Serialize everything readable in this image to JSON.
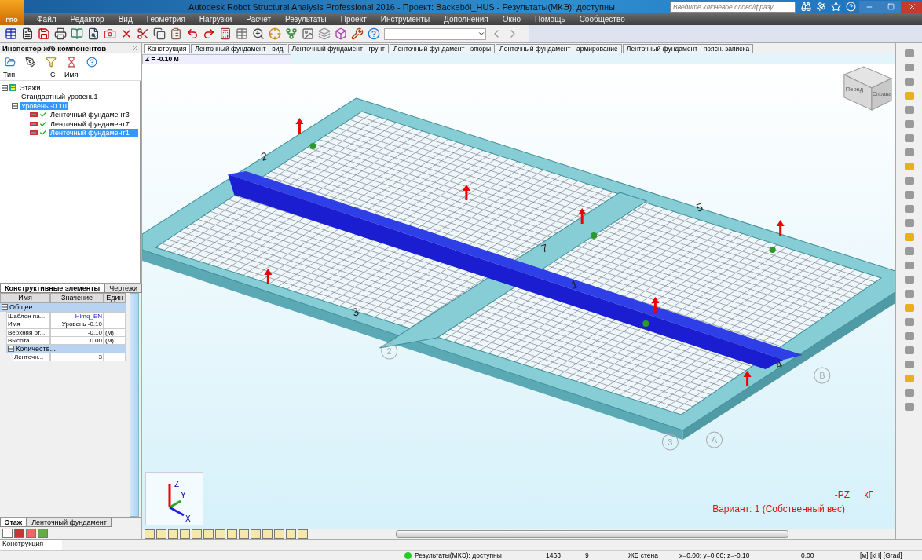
{
  "app": {
    "logo": "PRO",
    "title": "Autodesk Robot Structural Analysis Professional 2016 - Проект: Backeböl_HUS - Результаты(МКЭ): доступны",
    "search_placeholder": "Введите ключевое слово/фразу"
  },
  "menu": [
    "Файл",
    "Редактор",
    "Вид",
    "Геометрия",
    "Нагрузки",
    "Расчет",
    "Результаты",
    "Проект",
    "Инструменты",
    "Дополнения",
    "Окно",
    "Помощь",
    "Сообщество"
  ],
  "inspector": {
    "title": "Инспектор ж/б компонентов",
    "columns": [
      "Тип",
      "С",
      "Имя"
    ],
    "tree": [
      {
        "label": "Этажи",
        "kind": "storeys",
        "expanded": true,
        "selected": false,
        "children": [
          {
            "label": "Стандартный уровень1",
            "selected": false
          },
          {
            "label": "Уровень -0.10",
            "expanded": true,
            "selected": true,
            "children": [
              {
                "label": "Ленточный фундамент3",
                "kind": "footing",
                "checked": true,
                "selected": false
              },
              {
                "label": "Ленточный фундамент7",
                "kind": "footing",
                "checked": true,
                "selected": false
              },
              {
                "label": "Ленточный фундамент1",
                "kind": "footing",
                "checked": true,
                "selected": true
              }
            ]
          }
        ]
      }
    ],
    "tabs": [
      {
        "label": "Конструктивные элементы",
        "selected": true
      },
      {
        "label": "Чертежи",
        "selected": false
      }
    ]
  },
  "properties": {
    "columns": [
      "Имя",
      "Значение",
      "Един"
    ],
    "groups": [
      {
        "label": "Общее",
        "expanded": true,
        "rows": [
          {
            "name": "Шаблон па...",
            "value": "Himq_EN",
            "link": true
          },
          {
            "name": "Имя",
            "value": "Уровень -0.10",
            "link": false
          },
          {
            "name": "Верхняя от...",
            "value": "-0.10",
            "unit": "(м)",
            "link": false
          },
          {
            "name": "Высота",
            "value": "0.00",
            "unit": "(м)",
            "link": false
          }
        ],
        "children": [
          {
            "label": "Количеств...",
            "expanded": true,
            "rows": [
              {
                "name": "Ленточн...",
                "value": "3",
                "link": false
              }
            ]
          }
        ]
      }
    ]
  },
  "bottom_tabs": [
    {
      "label": "Этаж",
      "selected": true
    },
    {
      "label": "Ленточный фундамент",
      "selected": false
    }
  ],
  "view_tabs": [
    {
      "label": "Конструкция",
      "selected": true
    },
    {
      "label": "Ленточный фундамент - вид",
      "selected": false
    },
    {
      "label": "Ленточный фундамент - грунт",
      "selected": false
    },
    {
      "label": "Ленточный фундамент - эпюры",
      "selected": false
    },
    {
      "label": "Ленточный фундамент - армирование",
      "selected": false
    },
    {
      "label": "Ленточный фундамент - поясн. записка",
      "selected": false
    }
  ],
  "z_level": "Z = -0.10 м",
  "view_cube": [
    "Перед",
    "Справа"
  ],
  "strip_labels": [
    "2",
    "7",
    "5",
    "3",
    "1",
    "4"
  ],
  "grid_axes": [
    "2",
    "B",
    "3",
    "A"
  ],
  "axes": {
    "x": "X",
    "y": "Y",
    "z": "Z"
  },
  "result": {
    "component": "-PZ",
    "unit": "кГ",
    "case": "Вариант: 1 (Собственный вес)"
  },
  "footer_tab": "Конструкция",
  "status": {
    "message": "Результаты(МКЭ): доступны",
    "count": "1463",
    "number": "9",
    "element": "ЖБ стена",
    "coords": "x=0.00; y=0.00; z=-0.10",
    "value": "0.00",
    "units": "[м] [кН] [Grad]"
  }
}
